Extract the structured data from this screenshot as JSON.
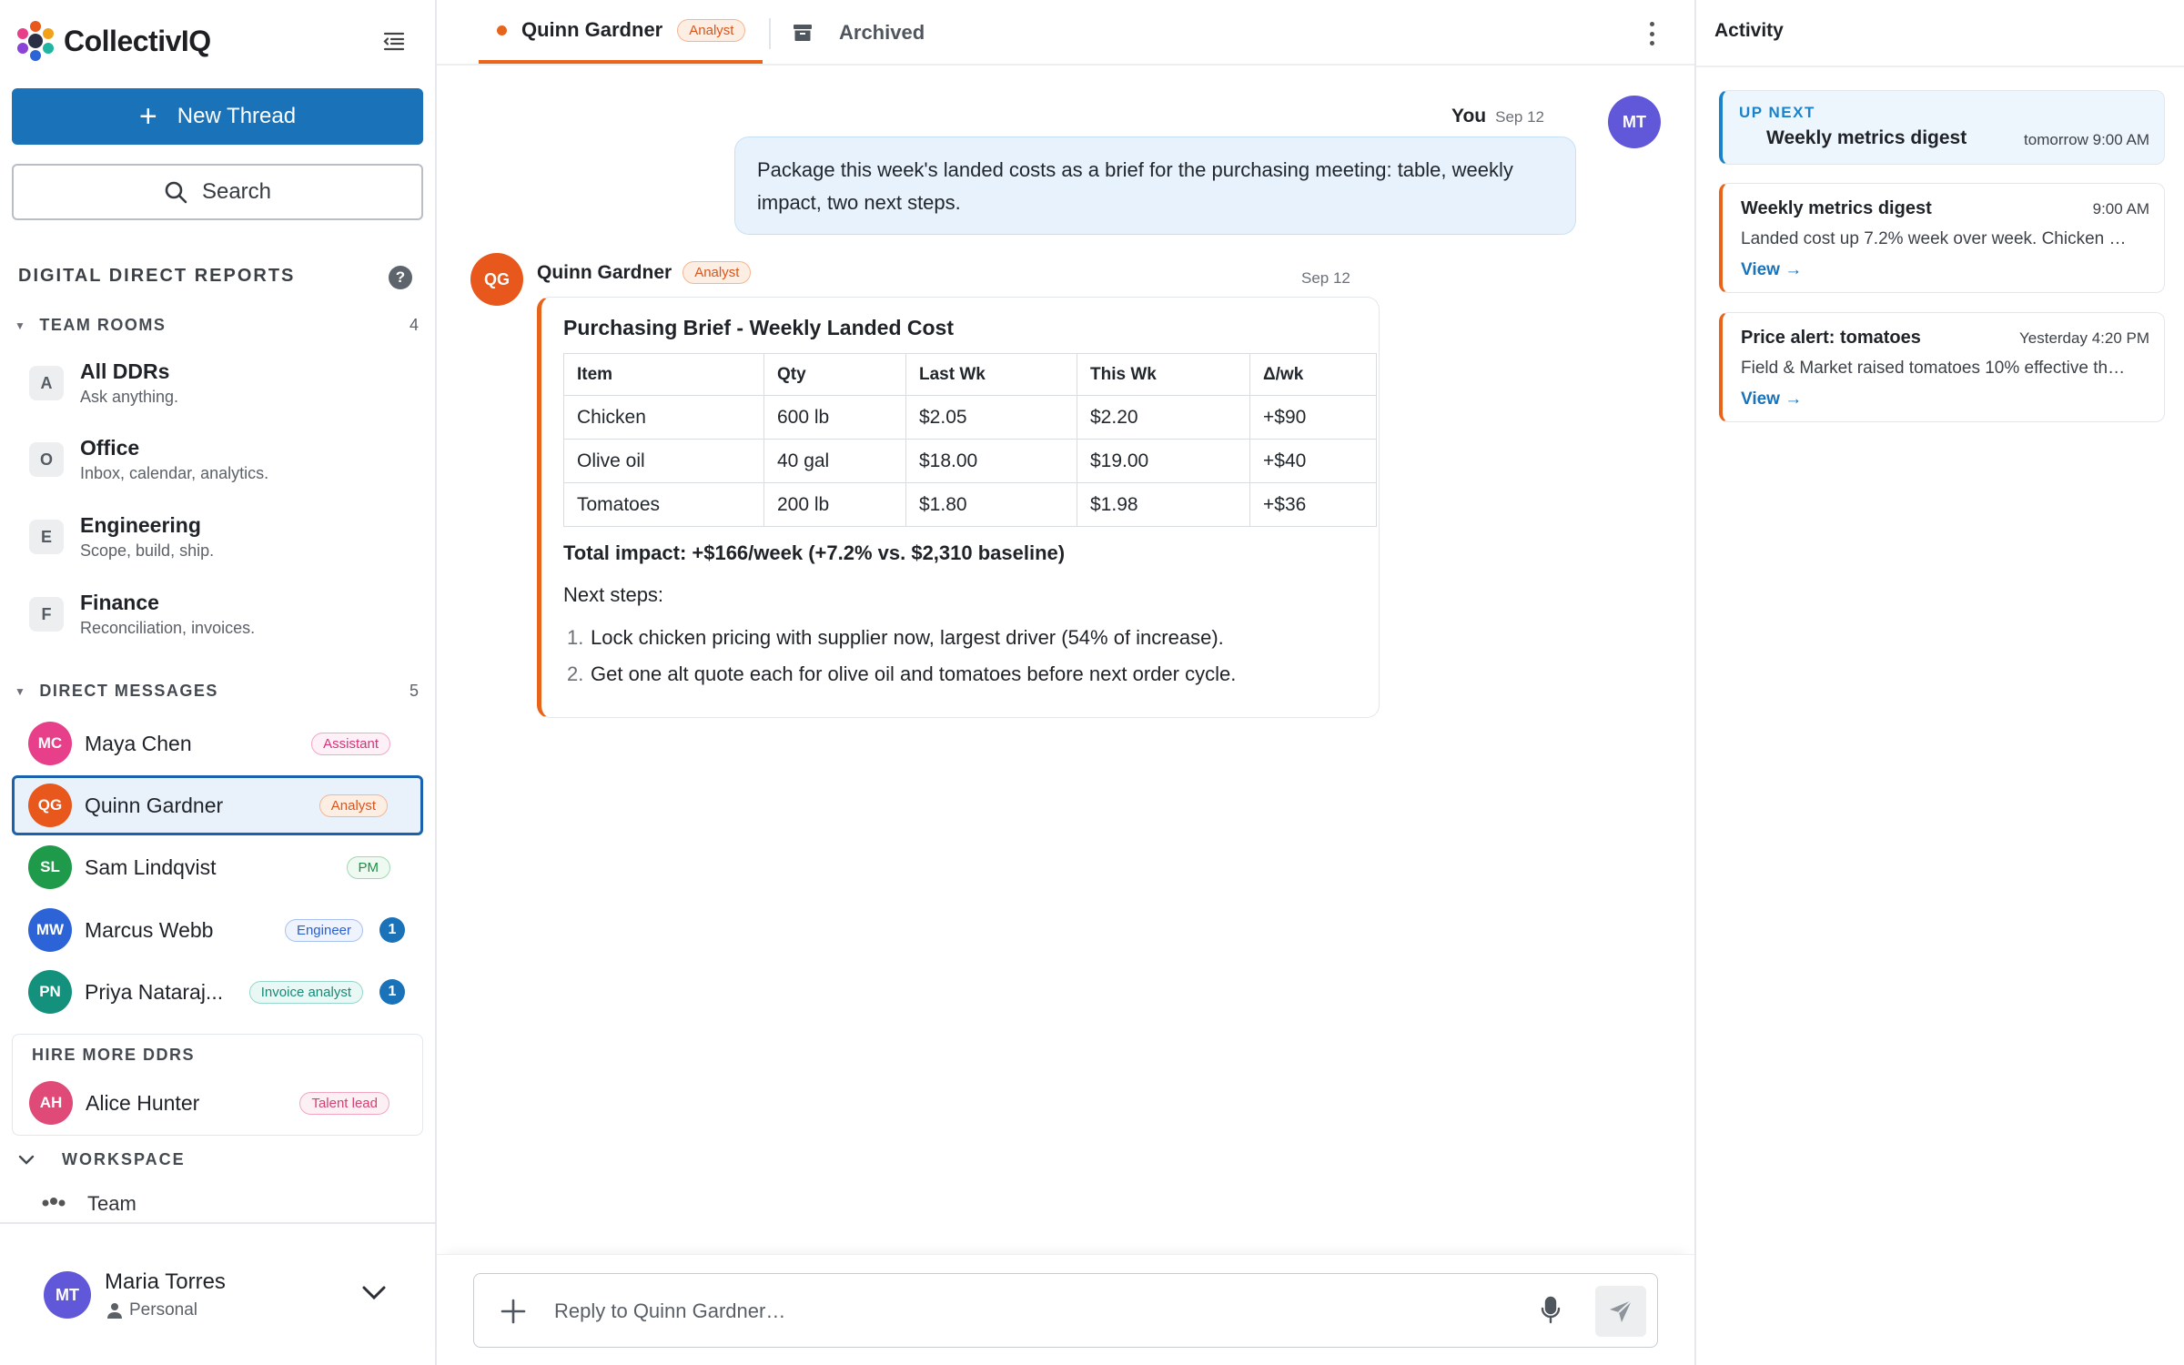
{
  "app": {
    "name": "CollectivIQ"
  },
  "sidebar": {
    "new_thread_label": "New Thread",
    "search_label": "Search",
    "section_title": "DIGITAL DIRECT REPORTS",
    "team_rooms": {
      "title": "TEAM ROOMS",
      "count": "4",
      "items": [
        {
          "letter": "A",
          "name": "All DDRs",
          "desc": "Ask anything."
        },
        {
          "letter": "O",
          "name": "Office",
          "desc": "Inbox, calendar, analytics."
        },
        {
          "letter": "E",
          "name": "Engineering",
          "desc": "Scope, build, ship."
        },
        {
          "letter": "F",
          "name": "Finance",
          "desc": "Reconciliation, invoices."
        }
      ]
    },
    "direct_messages": {
      "title": "DIRECT MESSAGES",
      "count": "5",
      "items": [
        {
          "initials": "MC",
          "name": "Maya Chen",
          "role": "Assistant",
          "color": "#e83f8a",
          "unread": ""
        },
        {
          "initials": "QG",
          "name": "Quinn Gardner",
          "role": "Analyst",
          "color": "#e8571b",
          "unread": ""
        },
        {
          "initials": "SL",
          "name": "Sam Lindqvist",
          "role": "PM",
          "color": "#1f9a4a",
          "unread": ""
        },
        {
          "initials": "MW",
          "name": "Marcus Webb",
          "role": "Engineer",
          "color": "#2c64d8",
          "unread": "1"
        },
        {
          "initials": "PN",
          "name": "Priya Nataraj...",
          "role": "Invoice analyst",
          "color": "#13917d",
          "unread": "1"
        }
      ]
    },
    "hire": {
      "title": "HIRE MORE DDRS",
      "item": {
        "initials": "AH",
        "name": "Alice Hunter",
        "role": "Talent lead",
        "color": "#e04a78"
      }
    },
    "workspace": {
      "title": "WORKSPACE",
      "team_label": "Team"
    },
    "user": {
      "initials": "MT",
      "name": "Maria Torres",
      "type": "Personal"
    }
  },
  "main": {
    "tabs": {
      "active_name": "Quinn Gardner",
      "active_role": "Analyst",
      "archived_label": "Archived"
    },
    "user_message": {
      "sender": "You",
      "time": "Sep 12",
      "initials": "MT",
      "text": "Package this week's landed costs as a brief for the purchasing meeting: table, weekly impact, two next steps."
    },
    "reply": {
      "initials": "QG",
      "sender": "Quinn Gardner",
      "role": "Analyst",
      "time": "Sep 12",
      "title": "Purchasing Brief - Weekly Landed Cost",
      "table": {
        "headers": [
          "Item",
          "Qty",
          "Last Wk",
          "This Wk",
          "Δ/wk"
        ],
        "rows": [
          [
            "Chicken",
            "600 lb",
            "$2.05",
            "$2.20",
            "+$90"
          ],
          [
            "Olive oil",
            "40 gal",
            "$18.00",
            "$19.00",
            "+$40"
          ],
          [
            "Tomatoes",
            "200 lb",
            "$1.80",
            "$1.98",
            "+$36"
          ]
        ]
      },
      "total": "Total impact: +$166/week (+7.2% vs. $2,310 baseline)",
      "next_label": "Next steps:",
      "steps": [
        {
          "num": "1.",
          "text": "Lock chicken pricing with supplier now, largest driver (54% of increase)."
        },
        {
          "num": "2.",
          "text": "Get one alt quote each for olive oil and tomatoes before next order cycle."
        }
      ]
    },
    "composer": {
      "placeholder": "Reply to Quinn Gardner…"
    }
  },
  "activity": {
    "title": "Activity",
    "up_next": {
      "label": "UP NEXT",
      "title": "Weekly metrics digest",
      "time": "tomorrow 9:00 AM"
    },
    "cards": [
      {
        "title": "Weekly metrics digest",
        "time": "9:00 AM",
        "body": "Landed cost up 7.2% week over week. Chicken …",
        "link": "View →"
      },
      {
        "title": "Price alert: tomatoes",
        "time": "Yesterday 4:20 PM",
        "body": "Field & Market raised tomatoes 10% effective th…",
        "link": "View →"
      }
    ]
  },
  "colors": {
    "accent": "#1a72b8",
    "orange": "#e8641b",
    "user_bubble": "#e7f2fd"
  }
}
